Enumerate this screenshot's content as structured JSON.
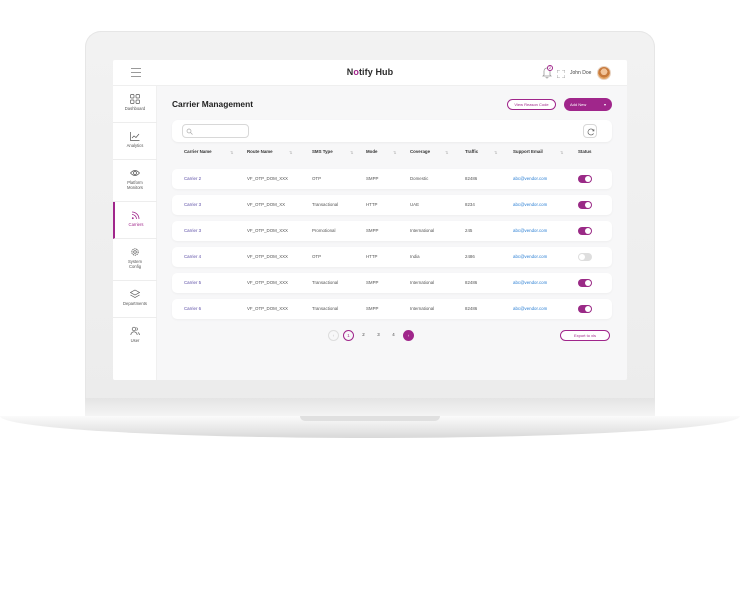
{
  "app": {
    "logo_prefix": "N",
    "logo_o": "o",
    "logo_suffix": "tify Hub",
    "notification_count": "2",
    "user_name": "John Doe"
  },
  "sidebar": {
    "items": [
      {
        "label_line1": "Dashboard",
        "label_line2": ""
      },
      {
        "label_line1": "Analytics",
        "label_line2": ""
      },
      {
        "label_line1": "Platform",
        "label_line2": "Monitors"
      },
      {
        "label_line1": "Carriers",
        "label_line2": ""
      },
      {
        "label_line1": "System",
        "label_line2": "Config"
      },
      {
        "label_line1": "Departments",
        "label_line2": ""
      },
      {
        "label_line1": "User",
        "label_line2": ""
      }
    ],
    "active": "Carriers"
  },
  "page": {
    "title": "Carrier Management",
    "view_reason_code_label": "View Reason Code",
    "add_new_label": "Add New",
    "search_placeholder": "",
    "export_label": "Export to xls"
  },
  "table": {
    "headers": [
      "Carrier Name",
      "Route Name",
      "SMS Type",
      "Mode",
      "Coverage",
      "Traffic",
      "Support  Email",
      "Status"
    ],
    "rows": [
      {
        "carrier": "Carrier 2",
        "route": "VF_OTP_DOM_XXX",
        "sms_type": "OTP",
        "mode": "SMPP",
        "coverage": "Domestic",
        "traffic": "82486",
        "email": "abc@vendor.com",
        "status": "on"
      },
      {
        "carrier": "Carrier 3",
        "route": "VF_OTP_DOM_XX",
        "sms_type": "Transactional",
        "mode": "HTTP",
        "coverage": "UAE",
        "traffic": "8234",
        "email": "abc@vendor.com",
        "status": "on"
      },
      {
        "carrier": "Carrier 3",
        "route": "VF_OTP_DOM_XXX",
        "sms_type": "Promotional",
        "mode": "SMPP",
        "coverage": "International",
        "traffic": "245",
        "email": "abc@vendor.com",
        "status": "on"
      },
      {
        "carrier": "Carrier 4",
        "route": "VF_OTP_DOM_XXX",
        "sms_type": "OTP",
        "mode": "HTTP",
        "coverage": "India",
        "traffic": "2486",
        "email": "abc@vendor.com",
        "status": "off"
      },
      {
        "carrier": "Carrier 5",
        "route": "VF_OTP_DOM_XXX",
        "sms_type": "Transactional",
        "mode": "SMPP",
        "coverage": "International",
        "traffic": "82486",
        "email": "abc@vendor.com",
        "status": "on"
      },
      {
        "carrier": "Carrier 6",
        "route": "VF_OTP_DOM_XXX",
        "sms_type": "Transactional",
        "mode": "SMPP",
        "coverage": "International",
        "traffic": "82486",
        "email": "abc@vendor.com",
        "status": "on"
      }
    ]
  },
  "pagination": {
    "prev": "‹",
    "pages": [
      "1",
      "2",
      "3",
      "4"
    ],
    "current": "1",
    "next": "›"
  },
  "colors": {
    "accent": "#a0268b",
    "link": "#2a7fd4",
    "carrier_text": "#5a4ba5"
  }
}
